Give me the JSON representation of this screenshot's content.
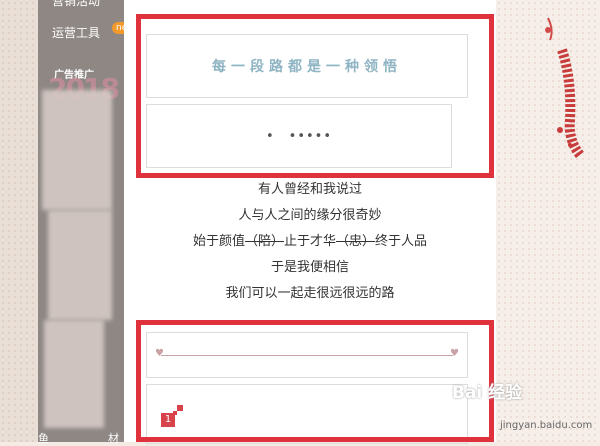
{
  "sidebar": {
    "item_top": "营销活动",
    "item_ops": "运营工具",
    "badge_new": "new",
    "item_ads": "广告推广",
    "year": "2018",
    "bottom_left": "鱼",
    "bottom_right": "材"
  },
  "editor": {
    "title": "每一段路都是一种领悟",
    "dots_left": "•",
    "dots_right": "•••••",
    "number_badge": "1"
  },
  "poem": {
    "line1": "有人曾经和我说过",
    "line2": "人与人之间的缘分很奇妙",
    "line3_a": "始于颜值",
    "line3_b": "（陪）",
    "line3_c": "止于才华",
    "line3_d": "（忠）",
    "line3_e": "终于人品",
    "line4": "于是我便相信",
    "line5": "我们可以一起走很远很远的路"
  },
  "watermark": {
    "brand": "Bai 经验",
    "sub": "jingyan.baidu.com"
  },
  "colors": {
    "highlight": "#e0323c",
    "title_text": "#8fb5c4",
    "sidebar_bg": "#8e8784",
    "badge_orange": "#f29a2b"
  }
}
